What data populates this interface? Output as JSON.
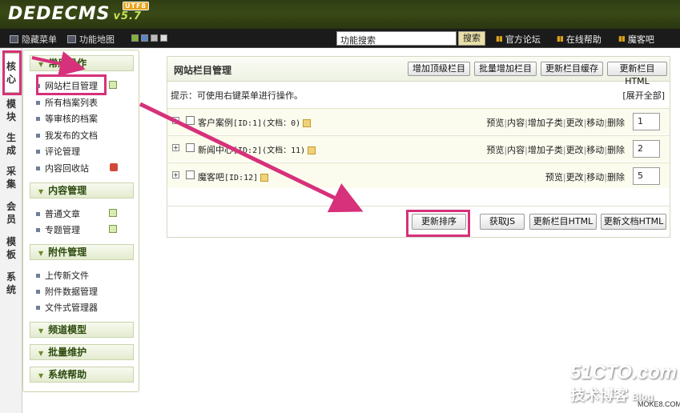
{
  "header": {
    "logo": "DEDECMS",
    "version": "v5.7",
    "badge": "UTF8"
  },
  "navbar": {
    "hide_menu": "隐藏菜单",
    "site_map": "功能地图",
    "search_placeholder": "功能搜索",
    "search_button": "搜索",
    "links": [
      "官方论坛",
      "在线帮助",
      "魔客吧"
    ]
  },
  "vtabs": [
    "核心",
    "模块",
    "生成",
    "采集",
    "会员",
    "模板",
    "系统"
  ],
  "sidebar": {
    "groups": [
      {
        "title": "常用操作",
        "items": [
          "网站栏目管理",
          "所有档案列表",
          "等审核的档案",
          "我发布的文档",
          "评论管理",
          "内容回收站"
        ]
      },
      {
        "title": "内容管理",
        "items": [
          "普通文章",
          "专题管理"
        ]
      },
      {
        "title": "附件管理",
        "items": [
          "上传新文件",
          "附件数据管理",
          "文件式管理器"
        ]
      },
      {
        "title": "频道模型",
        "items": []
      },
      {
        "title": "批量维护",
        "items": []
      },
      {
        "title": "系统帮助",
        "items": []
      }
    ]
  },
  "panel": {
    "title": "网站栏目管理",
    "buttons": [
      "增加顶级栏目",
      "批量增加栏目",
      "更新栏目缓存",
      "更新栏目HTML"
    ],
    "tip": "提示：可使用右键菜单进行操作。",
    "expand_all": "[展开全部]",
    "rows": [
      {
        "name": "客户案例",
        "meta": "[ID:1](文档：0)",
        "actions": [
          "预览",
          "内容",
          "增加子类",
          "更改",
          "移动",
          "删除"
        ],
        "order": "1"
      },
      {
        "name": "新闻中心",
        "meta": "[ID:2](文档：11)",
        "actions": [
          "预览",
          "内容",
          "增加子类",
          "更改",
          "移动",
          "删除"
        ],
        "order": "2"
      },
      {
        "name": "魔客吧",
        "meta": "[ID:12]",
        "actions": [
          "预览",
          "更改",
          "移动",
          "删除"
        ],
        "order": "5"
      }
    ],
    "bottom_buttons": [
      "更新排序",
      "获取JS",
      "更新栏目HTML",
      "更新文档HTML"
    ]
  },
  "watermark": {
    "line1": "51CTO.com",
    "line2": "技术博客",
    "line3": "Blog",
    "line4": "MOKE8.COM"
  },
  "colors": {
    "highlight": "#d6317a",
    "header": "#3a4a16",
    "group_text": "#2c4a0e"
  }
}
